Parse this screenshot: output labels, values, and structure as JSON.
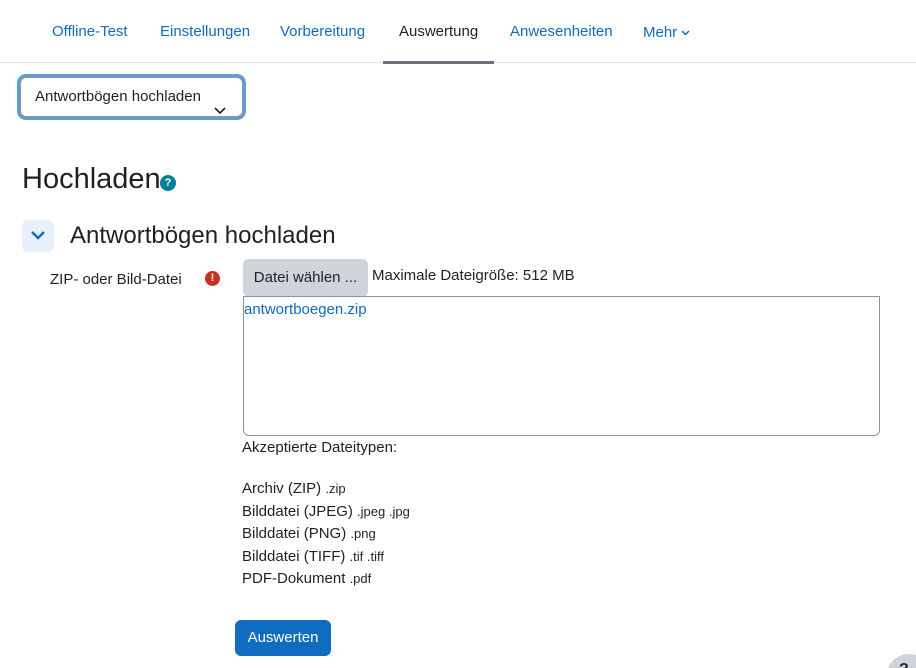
{
  "nav": {
    "tabs": [
      {
        "label": "Offline-Test"
      },
      {
        "label": "Einstellungen"
      },
      {
        "label": "Vorbereitung"
      },
      {
        "label": "Auswertung",
        "active": true
      },
      {
        "label": "Anwesenheiten"
      },
      {
        "label": "Mehr"
      }
    ]
  },
  "action_select": {
    "value": "Antwortbögen hochladen"
  },
  "page": {
    "title": "Hochladen",
    "help_glyph": "?"
  },
  "section": {
    "title": "Antwortbögen hochladen"
  },
  "form": {
    "field_label": "ZIP- oder Bild-Datei",
    "required_glyph": "!",
    "choose_button": "Datei wählen ...",
    "max_size": "Maximale Dateigröße: 512 MB",
    "file_name": "antwortboegen.zip",
    "accepted_title": "Akzeptierte Dateitypen:",
    "types": [
      {
        "name": "Archiv (ZIP)",
        "ext": ".zip"
      },
      {
        "name": "Bilddatei (JPEG)",
        "ext": ".jpeg .jpg"
      },
      {
        "name": "Bilddatei (PNG)",
        "ext": ".png"
      },
      {
        "name": "Bilddatei (TIFF)",
        "ext": ".tif .tiff"
      },
      {
        "name": "PDF-Dokument",
        "ext": ".pdf"
      }
    ],
    "submit_button": "Auswerten"
  },
  "floating_help": {
    "glyph": "?"
  },
  "colors": {
    "link": "#0f6cbf",
    "primary": "#0f6cbf",
    "required": "#ca3120",
    "help": "#008196"
  }
}
